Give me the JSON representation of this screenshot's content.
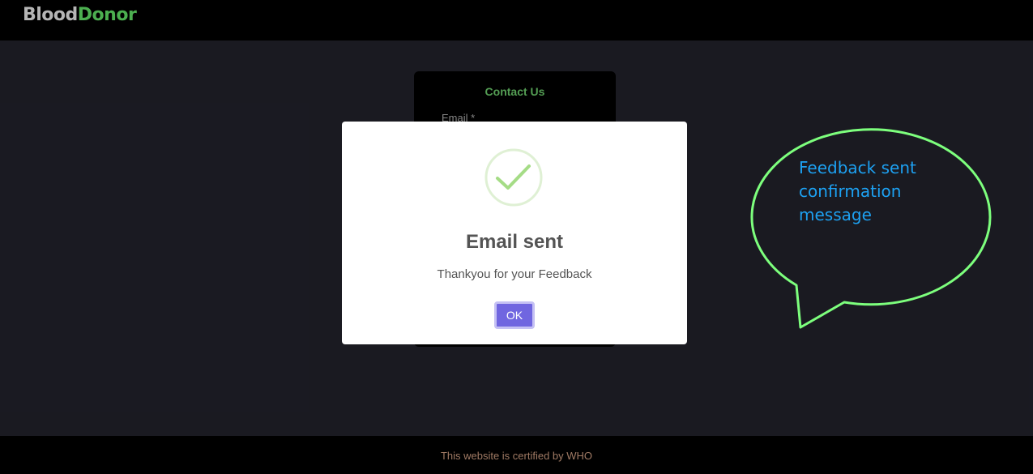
{
  "navbar": {
    "brand_part1": "Blood",
    "brand_part2": "Donor"
  },
  "contact_form": {
    "title": "Contact Us",
    "email_label": "Email *"
  },
  "modal": {
    "icon": "checkmark-icon",
    "title": "Email sent",
    "text": "Thankyou for your Feedback",
    "ok_label": "OK"
  },
  "annotation": {
    "text": "Feedback sent confirmation message"
  },
  "footer": {
    "text": "This website is certified by WHO"
  },
  "colors": {
    "brand_green": "#4caf50",
    "accent_purple": "#7066e0",
    "annotation_outline": "#7dff7d",
    "annotation_text": "#1da1f2"
  }
}
